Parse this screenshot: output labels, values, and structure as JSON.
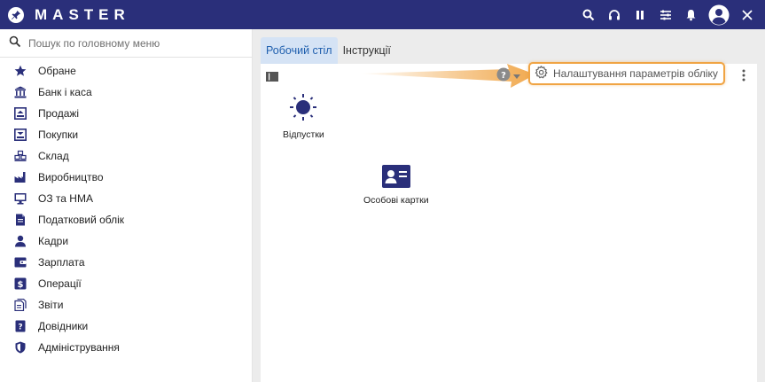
{
  "app": {
    "brand": "MASTER",
    "logo_icon": "pin-icon",
    "colors": {
      "topbar": "#2a2f7a",
      "accent": "#1f5fae",
      "highlight": "#f0a444",
      "icon": "#2a2f7a"
    },
    "top_icons": [
      "search-icon",
      "headset-icon",
      "pause-icon",
      "sliders-icon",
      "bell-icon",
      "user-avatar-icon",
      "close-icon"
    ]
  },
  "sidebar": {
    "search": {
      "placeholder": "Пошук по головному меню",
      "value": ""
    },
    "items": [
      {
        "label": "Обране",
        "icon": "star-icon"
      },
      {
        "label": "Банк і каса",
        "icon": "bank-icon"
      },
      {
        "label": "Продажі",
        "icon": "sales-icon"
      },
      {
        "label": "Покупки",
        "icon": "purchases-icon"
      },
      {
        "label": "Склад",
        "icon": "warehouse-icon"
      },
      {
        "label": "Виробництво",
        "icon": "factory-icon"
      },
      {
        "label": "ОЗ та НМА",
        "icon": "monitor-icon"
      },
      {
        "label": "Податковий облік",
        "icon": "tax-document-icon"
      },
      {
        "label": "Кадри",
        "icon": "person-icon"
      },
      {
        "label": "Зарплата",
        "icon": "wallet-icon"
      },
      {
        "label": "Операції",
        "icon": "dollar-icon"
      },
      {
        "label": "Звіти",
        "icon": "reports-icon"
      },
      {
        "label": "Довідники",
        "icon": "help-book-icon"
      },
      {
        "label": "Адміністрування",
        "icon": "shield-icon"
      }
    ]
  },
  "main": {
    "tabs": [
      {
        "label": "Робочий стіл",
        "active": true
      },
      {
        "label": "Інструкції",
        "active": false
      }
    ],
    "toolbar": {
      "settings_label": "Налаштування параметрів обліку"
    },
    "tiles": [
      {
        "label": "Відпустки",
        "icon": "sun-icon"
      },
      {
        "label": "Особові картки",
        "icon": "id-card-icon"
      }
    ]
  }
}
